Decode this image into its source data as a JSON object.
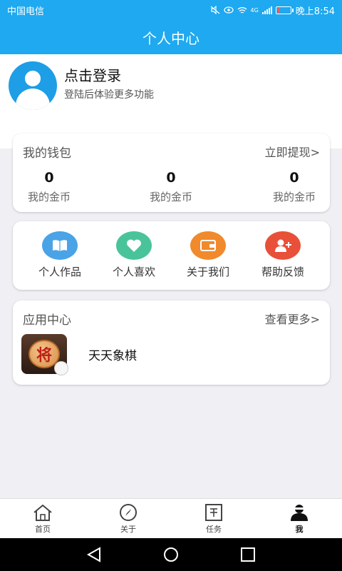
{
  "status_bar": {
    "carrier": "中国电信",
    "time": "晚上8:54",
    "network": "4G"
  },
  "header": {
    "title": "个人中心"
  },
  "profile": {
    "login_title": "点击登录",
    "login_subtitle": "登陆后体验更多功能"
  },
  "wallet": {
    "title": "我的钱包",
    "action": "立即提现>",
    "items": [
      {
        "value": "0",
        "label": "我的金币"
      },
      {
        "value": "0",
        "label": "我的金币"
      },
      {
        "value": "0",
        "label": "我的金币"
      }
    ]
  },
  "features": {
    "items": [
      {
        "label": "个人作品",
        "icon": "book-icon",
        "color": "#4aa3e6"
      },
      {
        "label": "个人喜欢",
        "icon": "heart-icon",
        "color": "#49c49a"
      },
      {
        "label": "关于我们",
        "icon": "wallet-icon",
        "color": "#f08a2c"
      },
      {
        "label": "帮助反馈",
        "icon": "add-user-icon",
        "color": "#e8503a"
      }
    ]
  },
  "apps": {
    "title": "应用中心",
    "more": "查看更多>",
    "items": [
      {
        "name": "天天象棋",
        "icon": "chess-icon",
        "icon_text": "将"
      }
    ]
  },
  "bottom_nav": {
    "items": [
      {
        "label": "首页",
        "icon": "home-icon"
      },
      {
        "label": "关于",
        "icon": "compass-icon"
      },
      {
        "label": "任务",
        "icon": "task-icon"
      },
      {
        "label": "我",
        "icon": "user-icon",
        "active": true
      }
    ]
  },
  "colors": {
    "accent": "#1ea9f0",
    "background": "#f0eff4"
  }
}
